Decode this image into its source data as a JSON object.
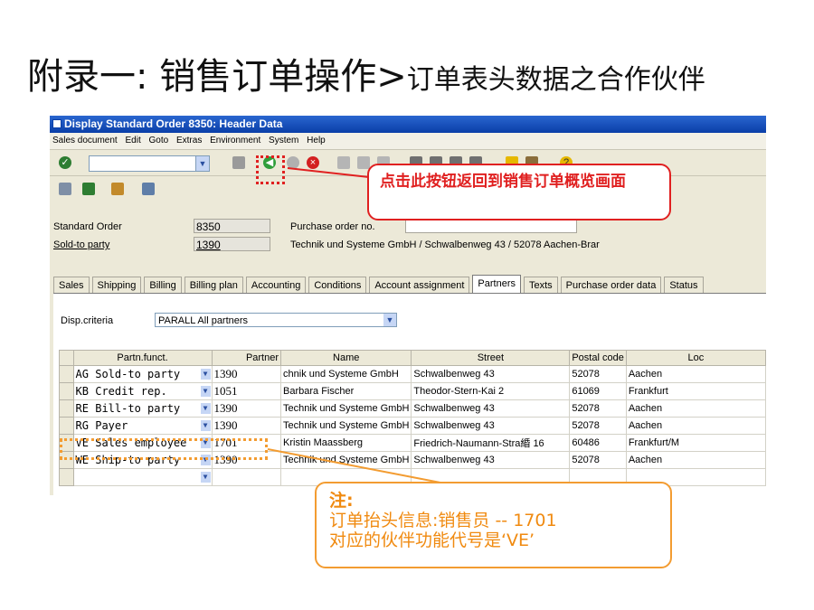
{
  "slide": {
    "title_big": "附录一: 销售订单操作>",
    "title_small": "订单表头数据之合作伙伴"
  },
  "window": {
    "title": "Display Standard Order 8350: Header Data",
    "menu": [
      "Sales document",
      "Edit",
      "Goto",
      "Extras",
      "Environment",
      "System",
      "Help"
    ]
  },
  "header": {
    "standard_order_label": "Standard Order",
    "standard_order_value": "8350",
    "po_label": "Purchase order no.",
    "po_value": "",
    "sold_to_label": "Sold-to party",
    "sold_to_value": "1390",
    "sold_to_desc": "Technik und Systeme GmbH / Schwalbenweg 43 / 52078 Aachen-Brar"
  },
  "tabs": [
    {
      "label": "Sales"
    },
    {
      "label": "Shipping"
    },
    {
      "label": "Billing"
    },
    {
      "label": "Billing plan"
    },
    {
      "label": "Accounting"
    },
    {
      "label": "Conditions"
    },
    {
      "label": "Account assignment"
    },
    {
      "label": "Partners"
    },
    {
      "label": "Texts"
    },
    {
      "label": "Purchase order data"
    },
    {
      "label": "Status"
    }
  ],
  "active_tab": "Partners",
  "partners": {
    "disp_criteria_label": "Disp.criteria",
    "disp_criteria_value": "PARALL All partners",
    "columns": [
      "Partn.funct.",
      "Partner",
      "Name",
      "Street",
      "Postal code",
      "Loc"
    ],
    "rows": [
      {
        "func": "AG Sold-to party",
        "partner": "1390",
        "name": "chnik und Systeme GmbH",
        "street": "Schwalbenweg 43",
        "postal": "52078",
        "loc": "Aachen"
      },
      {
        "func": "KB Credit rep.",
        "partner": "1051",
        "name": "Barbara Fischer",
        "street": "Theodor-Stern-Kai 2",
        "postal": "61069",
        "loc": "Frankfurt"
      },
      {
        "func": "RE Bill-to party",
        "partner": "1390",
        "name": "Technik und Systeme GmbH",
        "street": "Schwalbenweg 43",
        "postal": "52078",
        "loc": "Aachen"
      },
      {
        "func": "RG Payer",
        "partner": "1390",
        "name": "Technik und Systeme GmbH",
        "street": "Schwalbenweg 43",
        "postal": "52078",
        "loc": "Aachen"
      },
      {
        "func": "VE Sales employee",
        "partner": "1701",
        "name": "Kristin Maassberg",
        "street": "Friedrich-Naumann-Stra緍 16",
        "postal": "60486",
        "loc": "Frankfurt/M"
      },
      {
        "func": "WE Ship-to party",
        "partner": "1390",
        "name": "Technik und Systeme GmbH",
        "street": "Schwalbenweg 43",
        "postal": "52078",
        "loc": "Aachen"
      },
      {
        "func": "",
        "partner": "",
        "name": "",
        "street": "",
        "postal": "",
        "loc": ""
      }
    ]
  },
  "callouts": {
    "back_button": "点击此按钮返回到销售订单概览画面",
    "note_title": "注:",
    "note_line1": "订单抬头信息:销售员 -- 1701",
    "note_line2": "对应的伙伴功能代号是‘VE’"
  },
  "colors": {
    "red_callout": "#e02020",
    "orange_callout": "#f39c31",
    "title_bar": "#0a3fa8"
  }
}
